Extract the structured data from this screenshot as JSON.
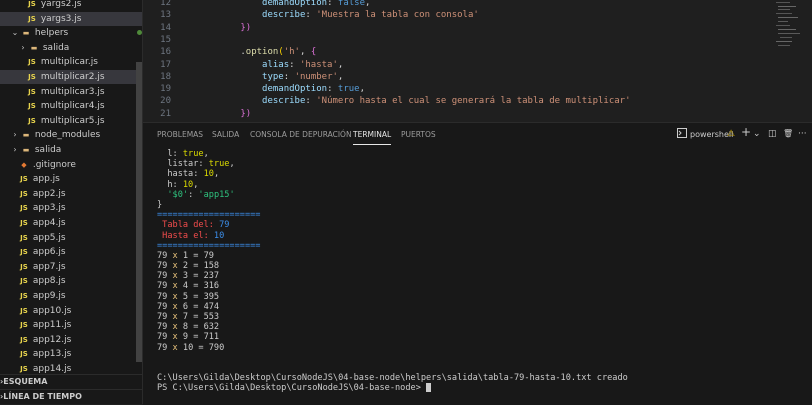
{
  "explorer": {
    "rows": [
      {
        "type": "file",
        "label": "yargs2.js",
        "icon": "JS",
        "indent": 26,
        "active": false
      },
      {
        "type": "file",
        "label": "yargs3.js",
        "icon": "JS",
        "indent": 26,
        "active": true
      },
      {
        "type": "folder-open",
        "label": "helpers",
        "indent": 10,
        "active": false,
        "dot": true
      },
      {
        "type": "folder",
        "label": "salida",
        "indent": 18,
        "active": false,
        "dot": true
      },
      {
        "type": "file",
        "label": "multiplicar.js",
        "icon": "JS",
        "indent": 26,
        "active": false
      },
      {
        "type": "file",
        "label": "multiplicar2.js",
        "icon": "JS",
        "indent": 26,
        "active": true
      },
      {
        "type": "file",
        "label": "multiplicar3.js",
        "icon": "JS",
        "indent": 26,
        "active": false
      },
      {
        "type": "file",
        "label": "multiplicar4.js",
        "icon": "JS",
        "indent": 26,
        "active": false
      },
      {
        "type": "file",
        "label": "multiplicar5.js",
        "icon": "JS",
        "indent": 26,
        "active": false
      },
      {
        "type": "folder",
        "label": "node_modules",
        "indent": 10,
        "active": false
      },
      {
        "type": "folder",
        "label": "salida",
        "indent": 10,
        "active": false
      },
      {
        "type": "git",
        "label": ".gitignore",
        "indent": 18,
        "active": false
      },
      {
        "type": "file",
        "label": "app.js",
        "icon": "JS",
        "indent": 18,
        "active": false
      },
      {
        "type": "file",
        "label": "app2.js",
        "icon": "JS",
        "indent": 18,
        "active": false
      },
      {
        "type": "file",
        "label": "app3.js",
        "icon": "JS",
        "indent": 18,
        "active": false
      },
      {
        "type": "file",
        "label": "app4.js",
        "icon": "JS",
        "indent": 18,
        "active": false
      },
      {
        "type": "file",
        "label": "app5.js",
        "icon": "JS",
        "indent": 18,
        "active": false
      },
      {
        "type": "file",
        "label": "app6.js",
        "icon": "JS",
        "indent": 18,
        "active": false
      },
      {
        "type": "file",
        "label": "app7.js",
        "icon": "JS",
        "indent": 18,
        "active": false
      },
      {
        "type": "file",
        "label": "app8.js",
        "icon": "JS",
        "indent": 18,
        "active": false
      },
      {
        "type": "file",
        "label": "app9.js",
        "icon": "JS",
        "indent": 18,
        "active": false
      },
      {
        "type": "file",
        "label": "app10.js",
        "icon": "JS",
        "indent": 18,
        "active": false
      },
      {
        "type": "file",
        "label": "app11.js",
        "icon": "JS",
        "indent": 18,
        "active": false
      },
      {
        "type": "file",
        "label": "app12.js",
        "icon": "JS",
        "indent": 18,
        "active": false
      },
      {
        "type": "file",
        "label": "app13.js",
        "icon": "JS",
        "indent": 18,
        "active": false
      },
      {
        "type": "file",
        "label": "app14.js",
        "icon": "JS",
        "indent": 18,
        "active": false
      }
    ],
    "sections": [
      "ESQUEMA",
      "LÍNEA DE TIEMPO"
    ]
  },
  "editor": {
    "lines": [
      {
        "n": "12",
        "tokens": [
          [
            "            ",
            "pl"
          ],
          [
            "demandOption",
            "prop"
          ],
          [
            ": ",
            "pl"
          ],
          [
            "false",
            "kw"
          ],
          [
            ",",
            "pl"
          ]
        ]
      },
      {
        "n": "13",
        "tokens": [
          [
            "            ",
            "pl"
          ],
          [
            "describe",
            "prop"
          ],
          [
            ": ",
            "pl"
          ],
          [
            "'Muestra la tabla con consola'",
            "str"
          ]
        ]
      },
      {
        "n": "14",
        "tokens": [
          [
            "        ",
            "pl"
          ],
          [
            "})",
            "br"
          ]
        ]
      },
      {
        "n": "15",
        "tokens": []
      },
      {
        "n": "16",
        "tokens": [
          [
            "        .",
            "pl"
          ],
          [
            "option",
            "fn"
          ],
          [
            "(",
            "br2"
          ],
          [
            "'h'",
            "str"
          ],
          [
            ", ",
            "pl"
          ],
          [
            "{",
            "br"
          ]
        ]
      },
      {
        "n": "17",
        "tokens": [
          [
            "            ",
            "pl"
          ],
          [
            "alias",
            "prop"
          ],
          [
            ": ",
            "pl"
          ],
          [
            "'hasta'",
            "str"
          ],
          [
            ",",
            "pl"
          ]
        ]
      },
      {
        "n": "18",
        "tokens": [
          [
            "            ",
            "pl"
          ],
          [
            "type",
            "prop"
          ],
          [
            ": ",
            "pl"
          ],
          [
            "'number'",
            "str"
          ],
          [
            ",",
            "pl"
          ]
        ]
      },
      {
        "n": "19",
        "tokens": [
          [
            "            ",
            "pl"
          ],
          [
            "demandOption",
            "prop"
          ],
          [
            ": ",
            "pl"
          ],
          [
            "true",
            "kw"
          ],
          [
            ",",
            "pl"
          ]
        ]
      },
      {
        "n": "20",
        "tokens": [
          [
            "            ",
            "pl"
          ],
          [
            "describe",
            "prop"
          ],
          [
            ": ",
            "pl"
          ],
          [
            "'Número hasta el cual se generará la tabla de multiplicar'",
            "str"
          ]
        ]
      },
      {
        "n": "21",
        "tokens": [
          [
            "        ",
            "pl"
          ],
          [
            "})",
            "br"
          ]
        ]
      }
    ]
  },
  "panel": {
    "tabs": [
      "PROBLEMAS",
      "SALIDA",
      "CONSOLA DE DEPURACIÓN",
      "TERMINAL",
      "PUERTOS"
    ],
    "active_tab": "TERMINAL",
    "shell_label": "powershell",
    "tools": {
      "warning": "⚠",
      "add": "+",
      "chevron": "⌄",
      "split": "◫",
      "trash": "🗑",
      "more": "···"
    }
  },
  "terminal": {
    "lines": [
      [
        [
          "  l: ",
          "pl"
        ],
        [
          "true",
          "num"
        ],
        [
          ",",
          "pl"
        ]
      ],
      [
        [
          "  listar: ",
          "pl"
        ],
        [
          "true",
          "num"
        ],
        [
          ",",
          "pl"
        ]
      ],
      [
        [
          "  hasta: ",
          "pl"
        ],
        [
          "10",
          "num"
        ],
        [
          ",",
          "pl"
        ]
      ],
      [
        [
          "  h: ",
          "pl"
        ],
        [
          "10",
          "num"
        ],
        [
          ",",
          "pl"
        ]
      ],
      [
        [
          "  ",
          "pl"
        ],
        [
          "'$0'",
          "str"
        ],
        [
          ": ",
          "pl"
        ],
        [
          "'app15'",
          "str"
        ]
      ],
      [
        [
          "}",
          "pl"
        ]
      ],
      [
        [
          "====================",
          "sep"
        ]
      ],
      [
        [
          " Tabla del: ",
          "red"
        ],
        [
          "79",
          "sep"
        ]
      ],
      [
        [
          " Hasta el: ",
          "red"
        ],
        [
          "10",
          "sep"
        ]
      ],
      [
        [
          "====================",
          "sep"
        ]
      ],
      [
        [
          "79 ",
          "pl"
        ],
        [
          "x",
          "x"
        ],
        [
          " 1 = 79",
          "pl"
        ]
      ],
      [
        [
          "79 ",
          "pl"
        ],
        [
          "x",
          "x"
        ],
        [
          " 2 = 158",
          "pl"
        ]
      ],
      [
        [
          "79 ",
          "pl"
        ],
        [
          "x",
          "x"
        ],
        [
          " 3 = 237",
          "pl"
        ]
      ],
      [
        [
          "79 ",
          "pl"
        ],
        [
          "x",
          "x"
        ],
        [
          " 4 = 316",
          "pl"
        ]
      ],
      [
        [
          "79 ",
          "pl"
        ],
        [
          "x",
          "x"
        ],
        [
          " 5 = 395",
          "pl"
        ]
      ],
      [
        [
          "79 ",
          "pl"
        ],
        [
          "x",
          "x"
        ],
        [
          " 6 = 474",
          "pl"
        ]
      ],
      [
        [
          "79 ",
          "pl"
        ],
        [
          "x",
          "x"
        ],
        [
          " 7 = 553",
          "pl"
        ]
      ],
      [
        [
          "79 ",
          "pl"
        ],
        [
          "x",
          "x"
        ],
        [
          " 8 = 632",
          "pl"
        ]
      ],
      [
        [
          "79 ",
          "pl"
        ],
        [
          "x",
          "x"
        ],
        [
          " 9 = 711",
          "pl"
        ]
      ],
      [
        [
          "79 ",
          "pl"
        ],
        [
          "x",
          "x"
        ],
        [
          " 10 = 790",
          "pl"
        ]
      ],
      [
        [
          "",
          "pl"
        ]
      ],
      [
        [
          "",
          "pl"
        ]
      ],
      [
        [
          "C:\\Users\\Gilda\\Desktop\\CursoNodeJS\\04-base-node\\helpers\\salida\\tabla-79-hasta-10.txt creado",
          "pl"
        ]
      ],
      [
        [
          "PS C:\\Users\\Gilda\\Desktop\\CursoNodeJS\\04-base-node> ",
          "pl"
        ]
      ]
    ]
  },
  "colors": {
    "accent": "#007acc",
    "bg": "#1f1f1f",
    "sidebar": "#181818"
  }
}
